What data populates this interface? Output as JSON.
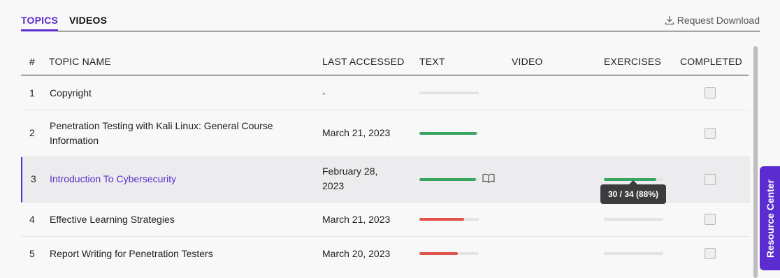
{
  "tabs": {
    "topics": "TOPICS",
    "videos": "VIDEOS"
  },
  "request_download": "Request Download",
  "columns": [
    "#",
    "TOPIC NAME",
    "LAST ACCESSED",
    "TEXT",
    "VIDEO",
    "EXERCISES",
    "COMPLETED"
  ],
  "rows": [
    {
      "num": "1",
      "title": "Copyright",
      "last_accessed": "-",
      "text_progress": 0,
      "text_color": "#e3e3e5",
      "exercises_progress": null,
      "completed": false
    },
    {
      "num": "2",
      "title": "Penetration Testing with Kali Linux: General Course Information",
      "last_accessed": "March 21, 2023",
      "text_progress": 0.97,
      "text_color": "#3aa563",
      "exercises_progress": null,
      "completed": false
    },
    {
      "num": "3",
      "title": "Introduction To Cybersecurity",
      "last_accessed": "February 28, 2023",
      "text_progress": 0.95,
      "text_color": "#3aa563",
      "exercises_progress": 0.88,
      "exercises_color": "#3aa563",
      "completed": false
    },
    {
      "num": "4",
      "title": "Effective Learning Strategies",
      "last_accessed": "March 21, 2023",
      "text_progress": 0.75,
      "text_color": "#e0524a",
      "exercises_progress": 0,
      "completed": false
    },
    {
      "num": "5",
      "title": "Report Writing for Penetration Testers",
      "last_accessed": "March 20, 2023",
      "text_progress": 0.65,
      "text_color": "#e0524a",
      "exercises_progress": 0,
      "completed": false
    }
  ],
  "tooltip": "30 / 34 (88%)",
  "resource_center": "Resource Center",
  "colors": {
    "accent": "#5b2ccf",
    "success": "#3aa563",
    "danger": "#e0524a"
  }
}
